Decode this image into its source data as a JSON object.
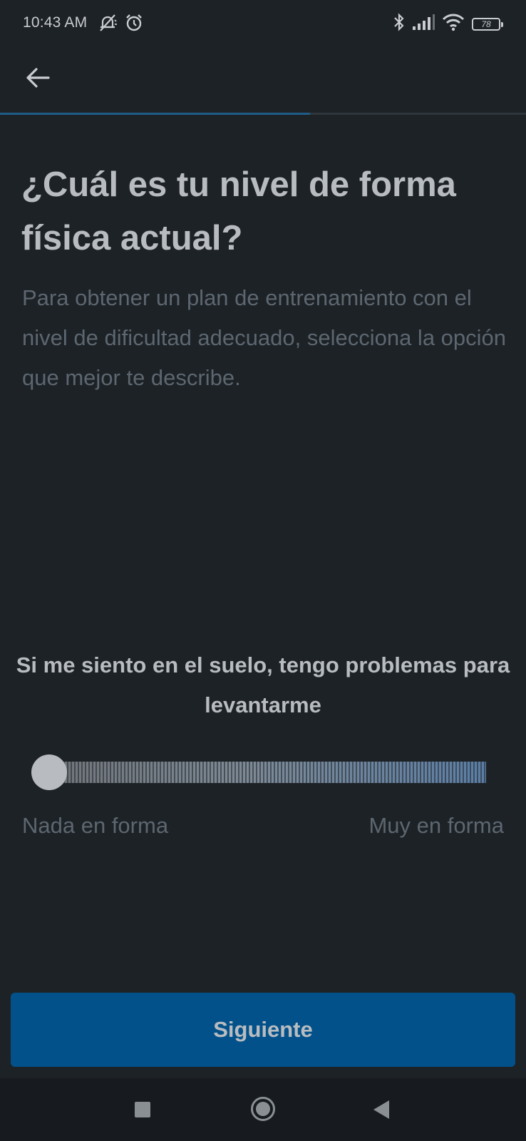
{
  "status_bar": {
    "time": "10:43 AM",
    "battery_level": "78",
    "left_icons": [
      "muted-notification-icon",
      "alarm-icon"
    ],
    "right_icons": [
      "bluetooth-icon",
      "signal-icon",
      "wifi-icon",
      "battery-icon"
    ]
  },
  "app_bar": {
    "back_icon": "arrow-left-icon"
  },
  "progress": {
    "fraction": 0.59,
    "color": "#1f5d89"
  },
  "question": {
    "title": "¿Cuál es tu nivel de forma física actual?",
    "subtitle": "Para obtener un plan de entrenamiento con el nivel de dificultad adecuado, selecciona la opción que mejor te describe."
  },
  "fitness_slider": {
    "level_description": "Si me siento en el suelo, tengo problemas para levantarme",
    "value": 0,
    "min_label": "Nada en forma",
    "max_label": "Muy en forma"
  },
  "next_button": {
    "label": "Siguiente",
    "color": "#03518a"
  },
  "nav_bar": {
    "icons": [
      "recents-icon",
      "home-icon",
      "back-icon"
    ]
  }
}
